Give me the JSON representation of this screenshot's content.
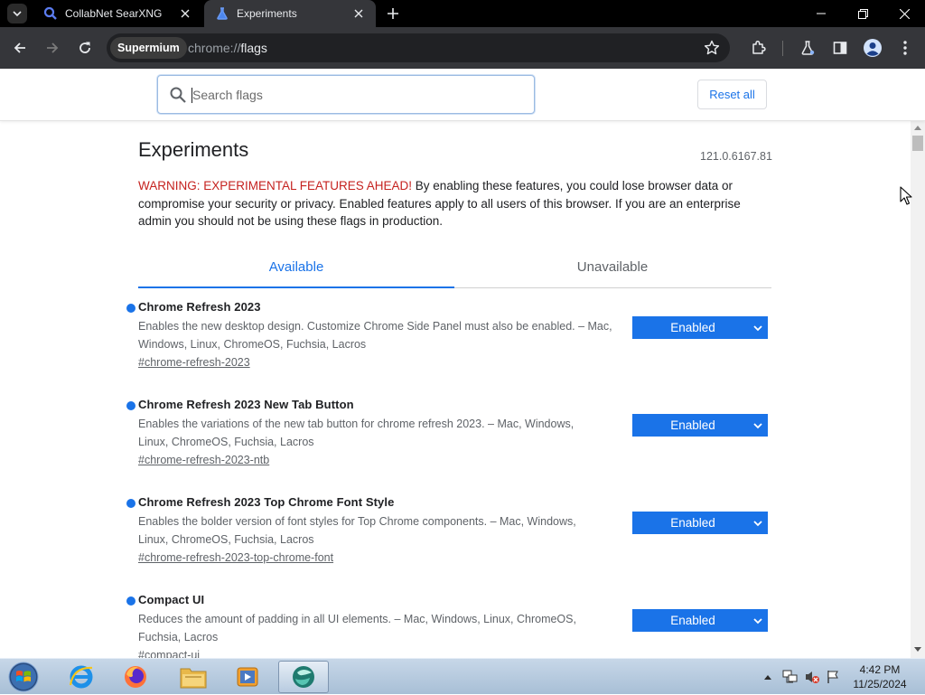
{
  "browser": {
    "tabs": [
      {
        "title": "CollabNet SearXNG",
        "icon": "search-icon",
        "active": false
      },
      {
        "title": "Experiments",
        "icon": "flask-icon",
        "active": true
      }
    ],
    "new_tab_label": "+",
    "address": {
      "chip_label": "Supermium",
      "url_scheme": "chrome://",
      "url_host": "flags"
    }
  },
  "flags": {
    "search": {
      "placeholder": "Search flags",
      "value": ""
    },
    "reset_label": "Reset all",
    "title": "Experiments",
    "version": "121.0.6167.81",
    "warning_strong": "WARNING: EXPERIMENTAL FEATURES AHEAD!",
    "warning_text": " By enabling these features, you could lose browser data or compromise your security or privacy. Enabled features apply to all users of this browser. If you are an enterprise admin you should not be using these flags in production.",
    "tabs": [
      {
        "label": "Available",
        "active": true
      },
      {
        "label": "Unavailable",
        "active": false
      }
    ],
    "experiments": [
      {
        "name": "Chrome Refresh 2023",
        "description": "Enables the new desktop design. Customize Chrome Side Panel must also be enabled. – Mac, Windows, Linux, ChromeOS, Fuchsia, Lacros",
        "link": "#chrome-refresh-2023",
        "state": "Enabled"
      },
      {
        "name": "Chrome Refresh 2023 New Tab Button",
        "description": "Enables the variations of the new tab button for chrome refresh 2023. – Mac, Windows, Linux, ChromeOS, Fuchsia, Lacros",
        "link": "#chrome-refresh-2023-ntb",
        "state": "Enabled"
      },
      {
        "name": "Chrome Refresh 2023 Top Chrome Font Style",
        "description": "Enables the bolder version of font styles for Top Chrome components. – Mac, Windows, Linux, ChromeOS, Fuchsia, Lacros",
        "link": "#chrome-refresh-2023-top-chrome-font",
        "state": "Enabled"
      },
      {
        "name": "Compact UI",
        "description": "Reduces the amount of padding in all UI elements. – Mac, Windows, Linux, ChromeOS, Fuchsia, Lacros",
        "link": "#compact-ui",
        "state": "Enabled"
      }
    ]
  },
  "taskbar": {
    "apps": [
      "internet-explorer-icon",
      "firefox-icon",
      "file-explorer-icon",
      "media-player-icon",
      "supermium-icon"
    ],
    "clock_time": "4:42 PM",
    "clock_date": "11/25/2024"
  },
  "colors": {
    "accent": "#1a73e8",
    "warning": "#c5221f",
    "toolbar": "#35363a",
    "tabstrip": "#000000"
  }
}
